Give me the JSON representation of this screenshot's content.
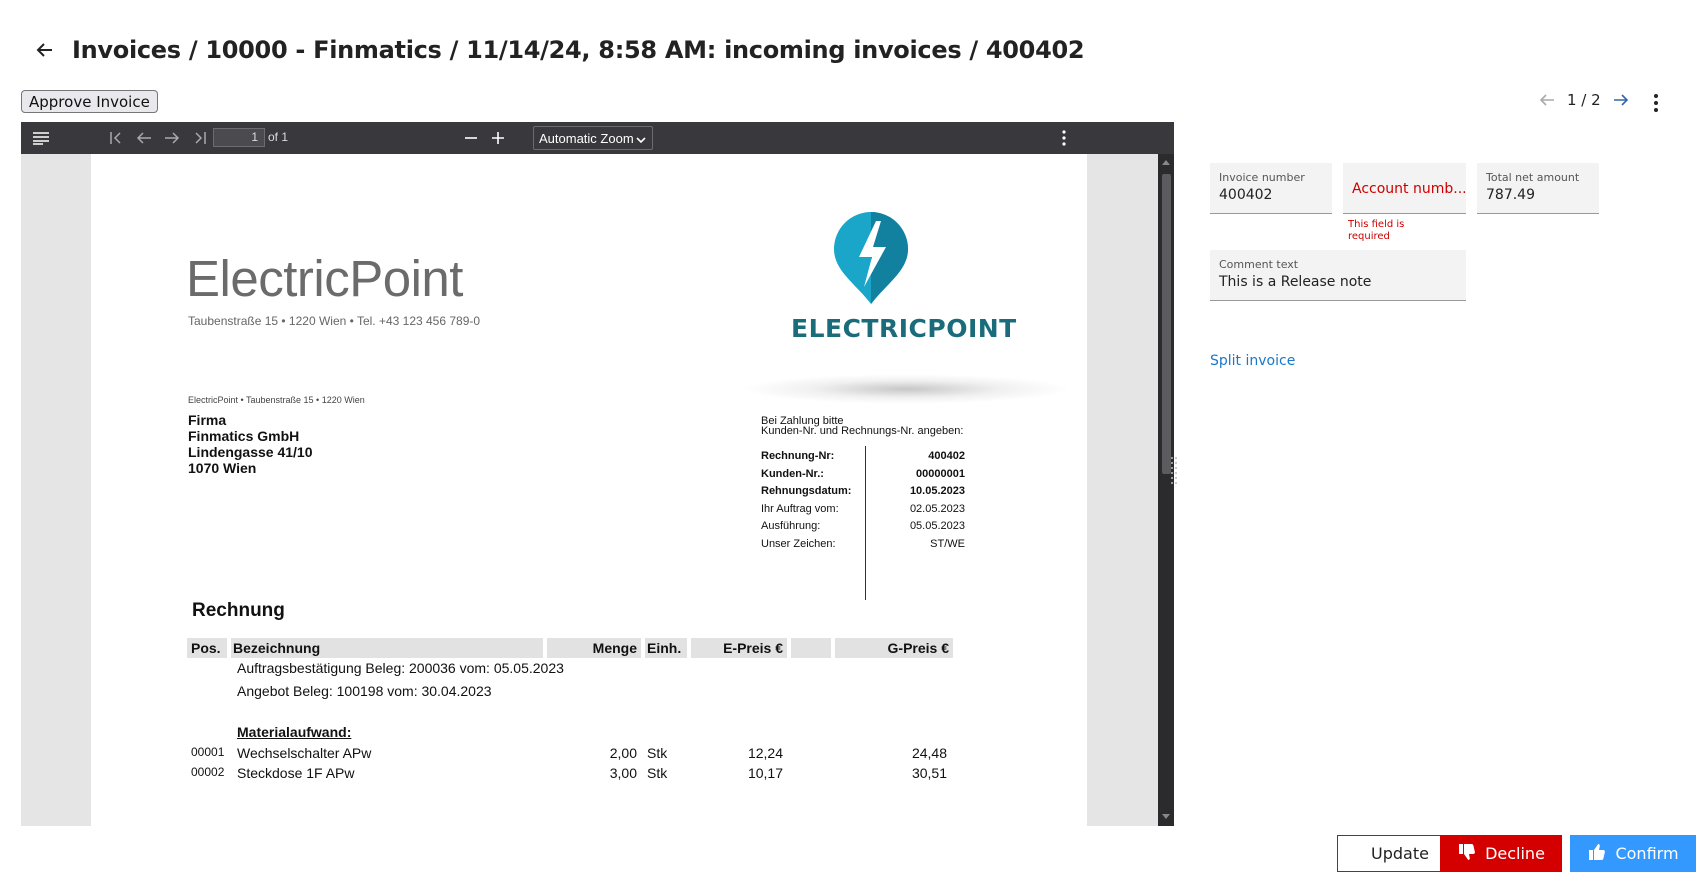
{
  "header": {
    "breadcrumb": "Invoices / 10000 - Finmatics / 11/14/24, 8:58 AM: incoming invoices / 400402"
  },
  "toolbar": {
    "approve_label": "Approve Invoice"
  },
  "pager": {
    "current": "1 / 2"
  },
  "pdf_viewer": {
    "page_number": "1",
    "page_total": "of 1",
    "zoom": "Automatic Zoom"
  },
  "invoice_doc": {
    "brand": "ElectricPoint",
    "brand_address": "Taubenstraße 15 • 1220 Wien • Tel. +43 123 456 789-0",
    "logo_text": "ELECTRICPOINT",
    "sender_line": "ElectricPoint • Taubenstraße 15 • 1220 Wien",
    "recipient": [
      "Firma",
      "Finmatics GmbH",
      "Lindengasse 41/10",
      "1070 Wien"
    ],
    "pay_hint_1": "Bei Zahlung bitte",
    "pay_hint_2": "Kunden-Nr. und Rechnungs-Nr. angeben:",
    "meta": [
      {
        "label": "Rechnung-Nr:",
        "value": "400402",
        "bold": true
      },
      {
        "label": "Kunden-Nr.:",
        "value": "00000001",
        "bold": true
      },
      {
        "label": "Rehnungsdatum:",
        "value": "10.05.2023",
        "bold": true
      },
      {
        "label": "Ihr Auftrag vom:",
        "value": "02.05.2023",
        "bold": false
      },
      {
        "label": "Ausführung:",
        "value": "05.05.2023",
        "bold": false
      },
      {
        "label": "Unser Zeichen:",
        "value": "ST/WE",
        "bold": false
      }
    ],
    "title": "Rechnung",
    "table_headers": {
      "pos": "Pos.",
      "bez": "Bezeichnung",
      "menge": "Menge",
      "einh": "Einh.",
      "epreis": "E-Preis €",
      "gpreis": "G-Preis €"
    },
    "notes": [
      "Auftragsbestätigung Beleg: 200036 vom: 05.05.2023",
      "Angebot Beleg: 100198 vom: 30.04.2023"
    ],
    "section": "Materialaufwand:",
    "rows": [
      {
        "pos": "00001",
        "bez": "Wechselschalter APw",
        "menge": "2,00",
        "einh": "Stk",
        "epreis": "12,24",
        "gpreis": "24,48"
      },
      {
        "pos": "00002",
        "bez": "Steckdose 1F APw",
        "menge": "3,00",
        "einh": "Stk",
        "epreis": "10,17",
        "gpreis": "30,51"
      }
    ]
  },
  "form": {
    "invoice_number": {
      "label": "Invoice number",
      "value": "400402"
    },
    "account_number": {
      "placeholder": "Account numb...",
      "error": "This field is required"
    },
    "total_net": {
      "label": "Total net amount",
      "value": "787.49"
    },
    "comment": {
      "label": "Comment text",
      "value": "This is a Release note"
    },
    "split_label": "Split invoice"
  },
  "actions": {
    "update": "Update",
    "decline": "Decline",
    "confirm": "Confirm"
  },
  "colors": {
    "decline": "#d40000",
    "confirm": "#3399ff",
    "error": "#cc0000",
    "link": "#1878c9",
    "logo": "#1a6c7a"
  }
}
